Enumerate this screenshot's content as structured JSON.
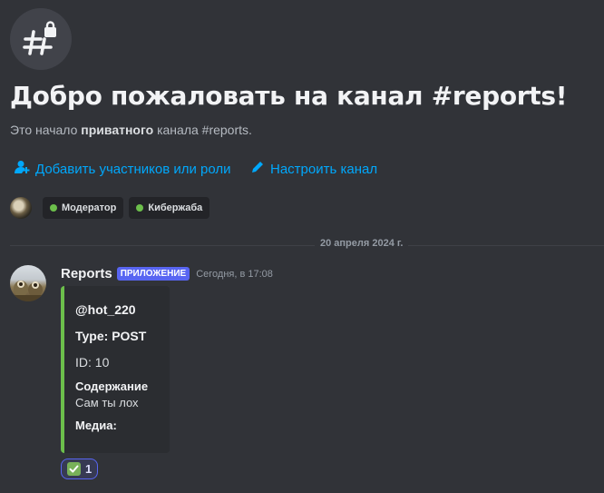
{
  "welcome": {
    "title": "Добро пожаловать на канал #reports!",
    "desc_prefix": "Это начало ",
    "desc_bold": "приватного",
    "desc_suffix": " канала #reports.",
    "channel_icon": "hashtag-lock-icon"
  },
  "actions": {
    "add_members_label": "Добавить участников или роли",
    "add_members_icon": "add-user-icon",
    "edit_channel_label": "Настроить канал",
    "edit_channel_icon": "pencil-icon"
  },
  "roles": [
    {
      "name": "Модератор",
      "color": "#6cbf4b"
    },
    {
      "name": "Кибержаба",
      "color": "#6cbf4b"
    }
  ],
  "date_divider": "20 апреля 2024 г.",
  "message": {
    "username": "Reports",
    "badge": "ПРИЛОЖЕНИЕ",
    "timestamp": "Сегодня, в 17:08",
    "embed": {
      "accent_color": "#6cbf4b",
      "author": "@hot_220",
      "title": "Type: POST",
      "description": "ID: 10",
      "fields": [
        {
          "name": "Содержание",
          "value": "Сам ты лох"
        },
        {
          "name": "Медиа:",
          "value": ""
        }
      ]
    },
    "reaction": {
      "emoji": "white-check-mark-icon",
      "count": "1"
    }
  },
  "colors": {
    "background": "#313338",
    "link": "#00a8fc",
    "badge": "#5865f2"
  }
}
